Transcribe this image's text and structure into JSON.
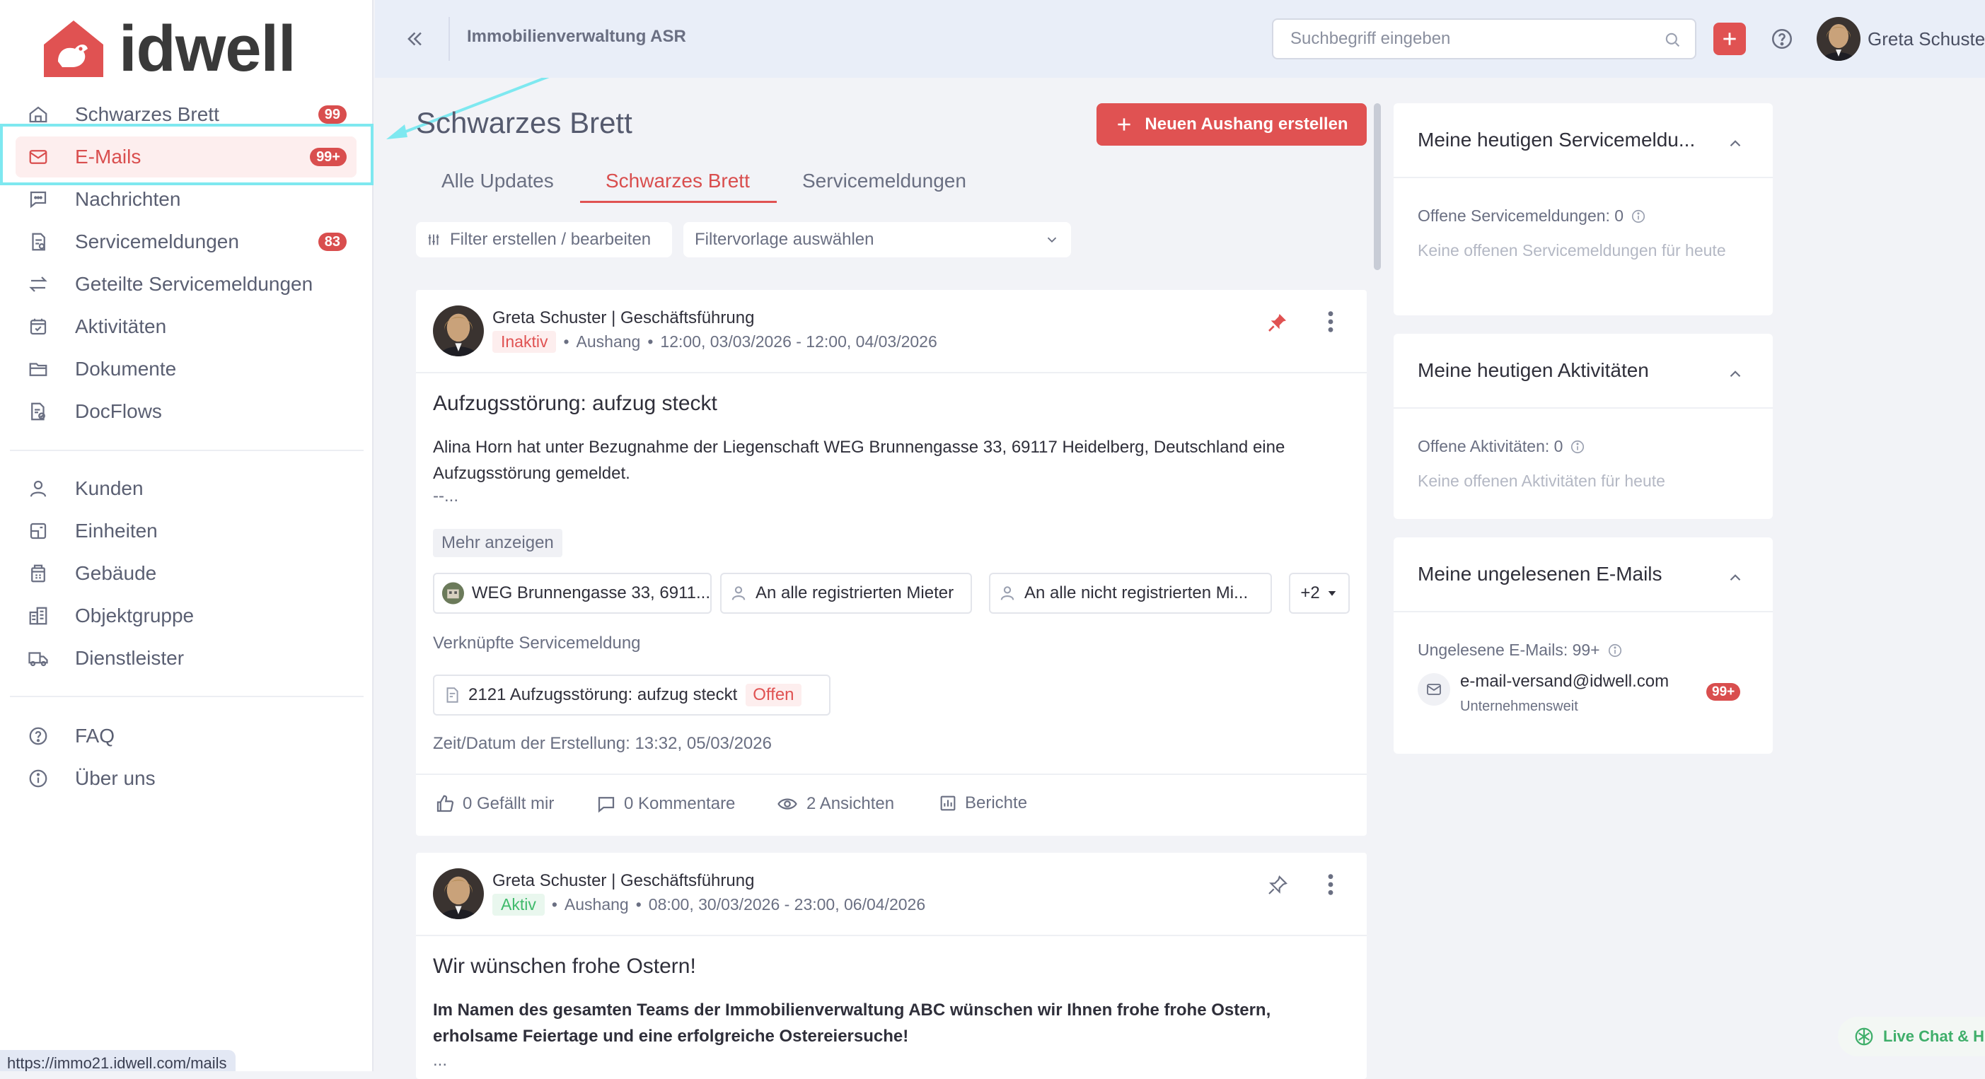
{
  "brand": {
    "logo_text": "idwell",
    "accent": "#e05252"
  },
  "sidebar": {
    "items": [
      {
        "label": "Schwarzes Brett",
        "badge": "99",
        "icon": "home-icon"
      },
      {
        "label": "E-Mails",
        "badge": "99+",
        "icon": "mail-icon",
        "active": true
      },
      {
        "label": "Nachrichten",
        "icon": "chat-icon"
      },
      {
        "label": "Servicemeldungen",
        "badge": "83",
        "icon": "service-report-icon"
      },
      {
        "label": "Geteilte Servicemeldungen",
        "icon": "swap-icon"
      },
      {
        "label": "Aktivitäten",
        "icon": "calendar-check-icon"
      },
      {
        "label": "Dokumente",
        "icon": "folder-icon"
      },
      {
        "label": "DocFlows",
        "icon": "docflow-icon"
      },
      {
        "label": "Kunden",
        "icon": "user-icon"
      },
      {
        "label": "Einheiten",
        "icon": "unit-icon"
      },
      {
        "label": "Gebäude",
        "icon": "building-icon"
      },
      {
        "label": "Objektgruppe",
        "icon": "building-group-icon"
      },
      {
        "label": "Dienstleister",
        "icon": "truck-icon"
      },
      {
        "label": "FAQ",
        "icon": "question-icon"
      },
      {
        "label": "Über uns",
        "icon": "info-icon"
      }
    ]
  },
  "status_bar": {
    "url": "https://immo21.idwell.com/mails"
  },
  "topbar": {
    "company": "Immobilienverwaltung ASR",
    "search_placeholder": "Suchbegriff eingeben",
    "user_name": "Greta Schuster"
  },
  "main": {
    "title": "Schwarzes Brett",
    "new_post_label": "Neuen Aushang erstellen",
    "tabs": [
      {
        "label": "Alle Updates"
      },
      {
        "label": "Schwarzes Brett",
        "active": true
      },
      {
        "label": "Servicemeldungen"
      }
    ],
    "filter_label": "Filter erstellen / bearbeiten",
    "filter_template_label": "Filtervorlage auswählen"
  },
  "posts": [
    {
      "author": "Greta Schuster | Geschäftsführung",
      "status": "Inaktiv",
      "type": "Aushang",
      "period": "12:00, 03/03/2026 - 12:00, 04/03/2026",
      "pinned": true,
      "title": "Aufzugsstörung: aufzug steckt",
      "body": "Alina Horn hat unter Bezugnahme der Liegenschaft WEG Brunnengasse 33, 69117 Heidelberg, Deutschland eine Aufzugsstörung gemeldet.",
      "body_more": "--...",
      "show_more": "Mehr anzeigen",
      "recipients": [
        "WEG Brunnengasse 33, 6911...",
        "An alle registrierten Mieter",
        "An alle nicht registrierten Mi...",
        "+2"
      ],
      "linked_label": "Verknüpfte Servicemeldung",
      "linked_item": "2121 Aufzugsstörung: aufzug steckt",
      "linked_status": "Offen",
      "created_at": "Zeit/Datum der Erstellung: 13:32, 05/03/2026",
      "likes": "0 Gefällt mir",
      "comments": "0 Kommentare",
      "views": "2 Ansichten",
      "reports": "Berichte"
    },
    {
      "author": "Greta Schuster | Geschäftsführung",
      "status": "Aktiv",
      "type": "Aushang",
      "period": "08:00, 30/03/2026 - 23:00, 06/04/2026",
      "pinned": false,
      "title": "Wir wünschen frohe Ostern!",
      "body": "Im Namen des gesamten Teams der Immobilienverwaltung ABC wünschen wir Ihnen frohe frohe Ostern, erholsame Feiertage und eine erfolgreiche Ostereiersuche!",
      "body_more": "..."
    }
  ],
  "right_panel": {
    "service": {
      "title": "Meine heutigen Servicemeldu...",
      "open_line": "Offene Servicemeldungen: 0",
      "empty": "Keine offenen Servicemeldungen für heute"
    },
    "activities": {
      "title": "Meine heutigen Aktivitäten",
      "open_line": "Offene Aktivitäten: 0",
      "empty": "Keine offenen Aktivitäten für heute"
    },
    "emails": {
      "title": "Meine ungelesenen E-Mails",
      "unread_line": "Ungelesene E-Mails: 99+",
      "mailbox": "e-mail-versand@idwell.com",
      "scope": "Unternehmensweit",
      "badge": "99+"
    }
  },
  "livechat": {
    "label": "Live Chat & H"
  }
}
